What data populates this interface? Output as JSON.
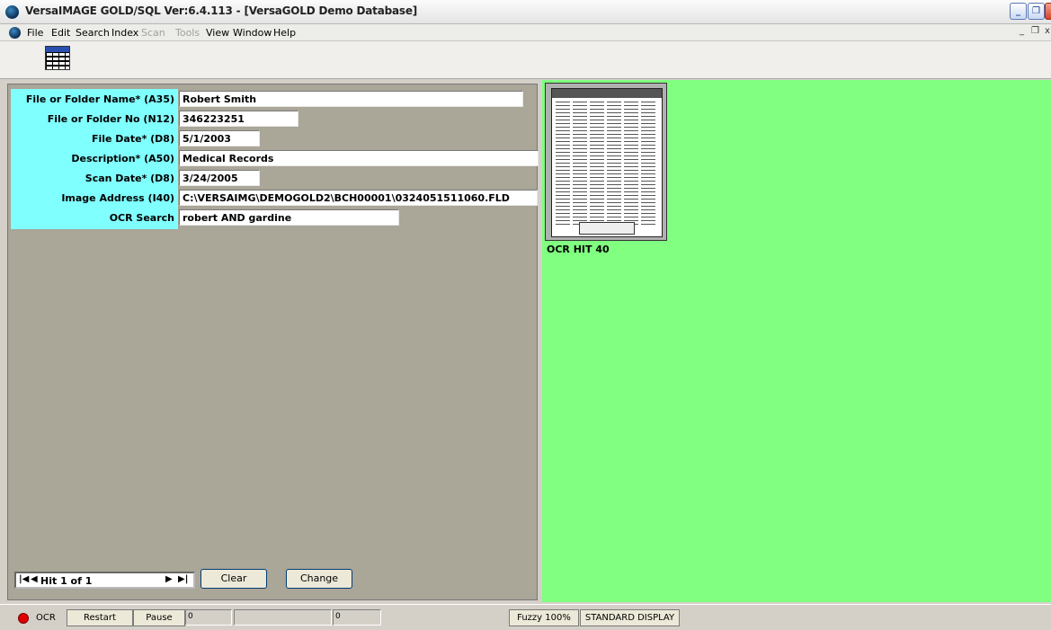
{
  "window": {
    "title": "VersaIMAGE GOLD/SQL Ver:6.4.113 - [VersaGOLD Demo Database]",
    "minimize": "_",
    "restore": "❐",
    "close": "✕"
  },
  "menu": {
    "items": [
      "File",
      "Edit",
      "Search",
      "Index",
      "Scan",
      "Tools",
      "View",
      "Window",
      "Help"
    ],
    "mdi_minimize": "_",
    "mdi_restore": "❐",
    "mdi_close": "x"
  },
  "toolbar": {
    "grid_icon": "table-grid-icon"
  },
  "form": {
    "fields": [
      {
        "label": "File or Folder Name* (A35)",
        "value": "Robert Smith"
      },
      {
        "label": "File or Folder No (N12)",
        "value": "346223251"
      },
      {
        "label": "File Date* (D8)",
        "value": "5/1/2003"
      },
      {
        "label": "Description* (A50)",
        "value": "Medical Records"
      },
      {
        "label": "Scan Date* (D8)",
        "value": "3/24/2005"
      },
      {
        "label": "Image Address (I40)",
        "value": "C:\\VERSAIMG\\DEMOGOLD2\\BCH00001\\0324051511060.FLD"
      },
      {
        "label": "OCR Search",
        "value": "robert AND gardine"
      }
    ]
  },
  "navigator": {
    "first": "|◀",
    "prev": "◀",
    "hit_text": "Hit 1 of 1",
    "next": "▶",
    "last": "▶|"
  },
  "buttons": {
    "clear": "Clear",
    "change": "Change"
  },
  "preview": {
    "caption": "OCR HIT 40"
  },
  "statusbar": {
    "ocr_label": "OCR",
    "restart": "Restart",
    "pause": "Pause",
    "field1": "0",
    "field3": "0",
    "fuzzy": "Fuzzy 100%",
    "display": "STANDARD DISPLAY",
    "ocr_indicator_color": "#e00000"
  },
  "colors": {
    "label_panel": "#80ffff",
    "preview_bg": "#80ff80",
    "form_bg": "#aaa698"
  }
}
